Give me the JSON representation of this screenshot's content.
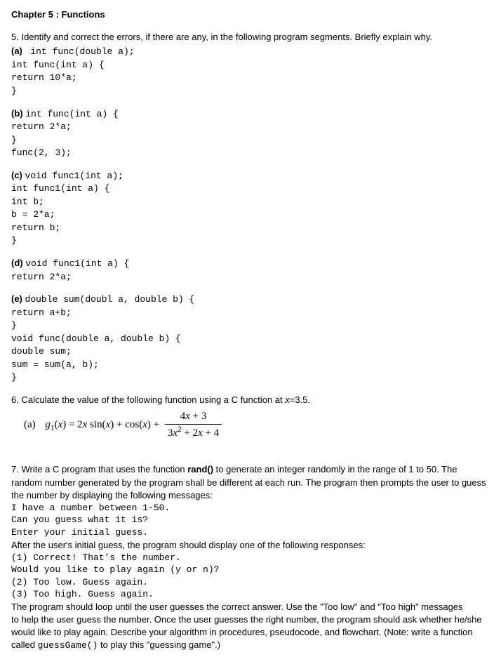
{
  "chapter_title": "Chapter 5 : Functions",
  "p5": {
    "prompt": "5. Identify and correct the errors, if there are any, in the following program segments. Briefly explain why.",
    "a_label": "(a)",
    "a_code": "int func(double a);\nint func(int a) {\nreturn 10*a;\n}",
    "b_label": "(b)",
    "b_code": "int func(int a) {\nreturn 2*a;\n}\nfunc(2, 3);",
    "c_label": "(c)",
    "c_code": "void func1(int a);\nint func1(int a) {\nint b;\nb = 2*a;\nreturn b;\n}",
    "d_label": "(d)",
    "d_code": "void func1(int a) {\nreturn 2*a;",
    "e_label": "(e)",
    "e_code": "double sum(doubl a, double b) {\nreturn a+b;\n}\nvoid func(double a, double b) {\ndouble sum;\nsum = sum(a, b);\n}"
  },
  "p6": {
    "prompt_prefix": "6. Calculate the value of the following function using a C function at ",
    "prompt_x": "x",
    "prompt_suffix": "=3.5.",
    "a_label": "(a)",
    "g_label": "g",
    "g_sub": "1",
    "lhs_open": "(",
    "lhs_var": "x",
    "lhs_close": ") = 2",
    "sinx": " sin(",
    "plus_cos": ") + cos(",
    "close_plus": ") + ",
    "frac_num_a": "4",
    "frac_num_b": " + 3",
    "frac_den_a": "3",
    "frac_den_sup": "2",
    "frac_den_b": " + 2",
    "frac_den_c": " + 4"
  },
  "p7": {
    "line1_a": "7. Write a C program that uses the function ",
    "line1_b": "rand()",
    "line1_c": " to generate an integer randomly in the range of 1 to 50. The random number generated by the program shall be different at each run. The program then prompts the user to guess the number by displaying the following messages:",
    "msg1": "I have a number between 1-50.",
    "msg2": "Can you guess what it is?",
    "msg3": "Enter your initial guess.",
    "line2": "After the user's initial guess, the program should display one of the following responses:",
    "resp1": "(1) Correct! That's the number.",
    "resp2": "Would you like to play again (y or n)?",
    "resp3": "(2) Too low. Guess again.",
    "resp4": "(3) Too high. Guess again.",
    "line3": "The program should loop until the user guesses the correct answer. Use the \"Too low\" and \"Too high\" messages",
    "line4_a": "to help the user guess the number. Once the user guesses the right number, the program should ask whether he/she would like to play again. Describe your algorithm in procedures, pseudocode, and flowchart. (Note: write a function called ",
    "line4_b": "guessGame()",
    "line4_c": " to play this \"guessing game\".)"
  }
}
